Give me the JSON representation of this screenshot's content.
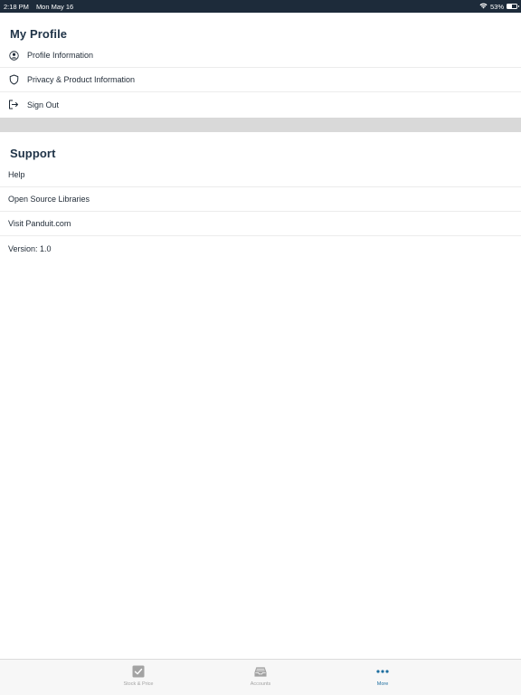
{
  "status_bar": {
    "time": "2:18 PM",
    "date": "Mon May 16",
    "battery_percent": "53%",
    "battery_level": 0.53
  },
  "my_profile": {
    "title": "My Profile",
    "items": [
      {
        "label": "Profile Information",
        "icon": "user-circle-icon"
      },
      {
        "label": "Privacy & Product Information",
        "icon": "shield-icon"
      },
      {
        "label": "Sign Out",
        "icon": "sign-out-icon"
      }
    ]
  },
  "support": {
    "title": "Support",
    "items": [
      {
        "label": "Help"
      },
      {
        "label": "Open Source Libraries"
      },
      {
        "label": "Visit Panduit.com"
      },
      {
        "label": "Version: 1.0"
      }
    ]
  },
  "tab_bar": {
    "tabs": [
      {
        "label": "Stock & Price",
        "icon": "checkbox-icon",
        "active": false
      },
      {
        "label": "Accounts",
        "icon": "inbox-icon",
        "active": false
      },
      {
        "label": "More",
        "icon": "more-dots-icon",
        "active": true
      }
    ]
  },
  "colors": {
    "status_bar_bg": "#1d2b3a",
    "section_title": "#1f3347",
    "divider_band": "#d9d9d9",
    "tab_active": "#1f6fa0",
    "tab_inactive": "#a3a3a3"
  }
}
